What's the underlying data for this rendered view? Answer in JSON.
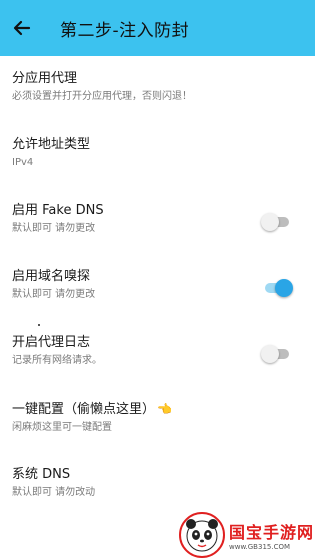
{
  "appbar": {
    "title": "第二步-注入防封",
    "color": "#3cc2ef"
  },
  "settings": [
    {
      "title": "分应用代理",
      "subtitle": "必须设置并打开分应用代理，否则闪退！",
      "toggle": null
    },
    {
      "title": "允许地址类型",
      "subtitle": "IPv4",
      "toggle": null
    },
    {
      "title": "启用 Fake DNS",
      "subtitle": "默认即可 请勿更改",
      "toggle": "off"
    },
    {
      "title": "启用域名嗅探",
      "subtitle": "默认即可 请勿更改",
      "toggle": "on"
    },
    {
      "title": "开启代理日志",
      "subtitle": "记录所有网络请求。",
      "toggle": "off"
    },
    {
      "title": "一键配置（偷懒点这里）",
      "subtitle": "闲麻烦这里可一键配置",
      "toggle": null,
      "trailing_icon": "pointing-hand-icon"
    },
    {
      "title": "系统 DNS",
      "subtitle": "默认即可 请勿改动",
      "toggle": null
    }
  ],
  "watermark": {
    "brand": "国宝手游网",
    "url": "www.GB315.COM"
  }
}
